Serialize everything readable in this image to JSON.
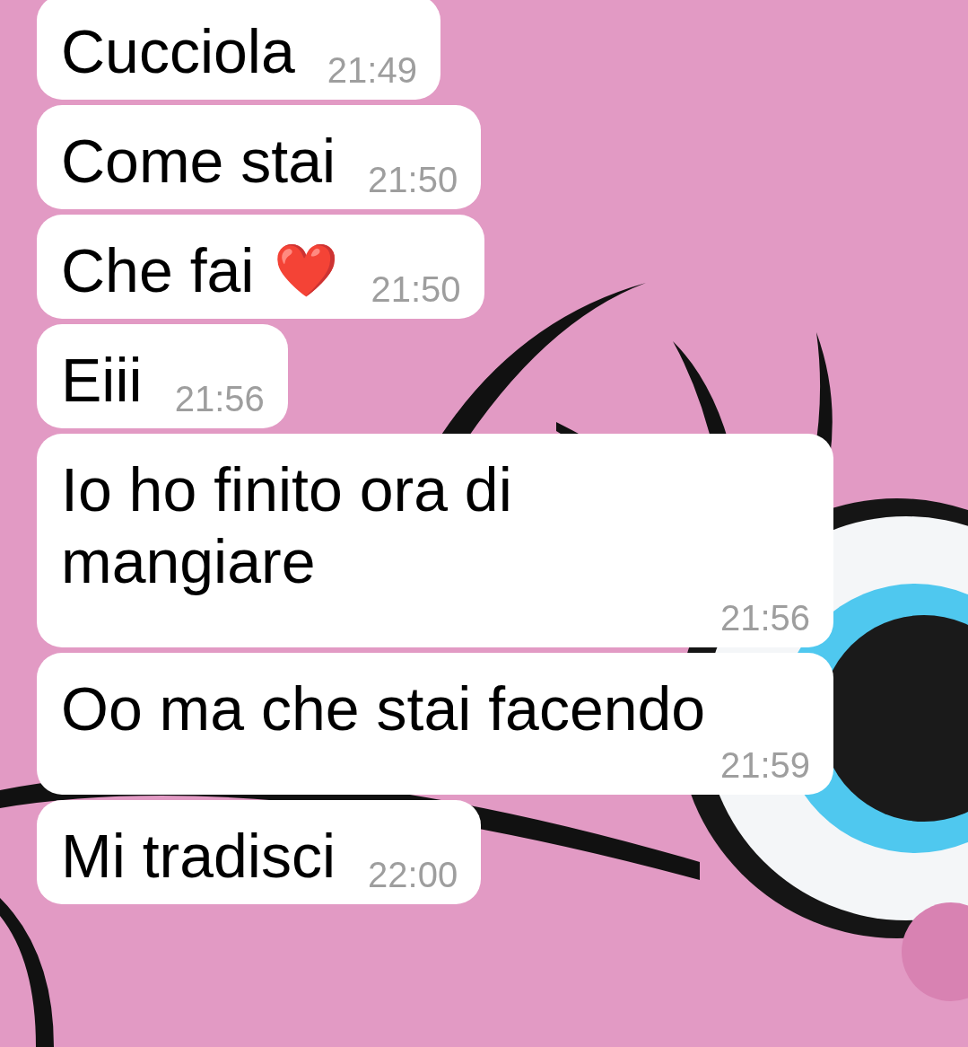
{
  "messages": [
    {
      "text": "Cucciola",
      "time": "21:49"
    },
    {
      "text": "Come stai",
      "time": "21:50"
    },
    {
      "text": "Che fai",
      "emoji": "❤️",
      "time": "21:50"
    },
    {
      "text": "Eiii",
      "time": "21:56"
    },
    {
      "text": "Io ho finito ora di mangiare",
      "time": "21:56"
    },
    {
      "text": "Oo ma che stai facendo",
      "time": "21:59"
    },
    {
      "text": "Mi tradisci",
      "time": "22:00"
    }
  ]
}
